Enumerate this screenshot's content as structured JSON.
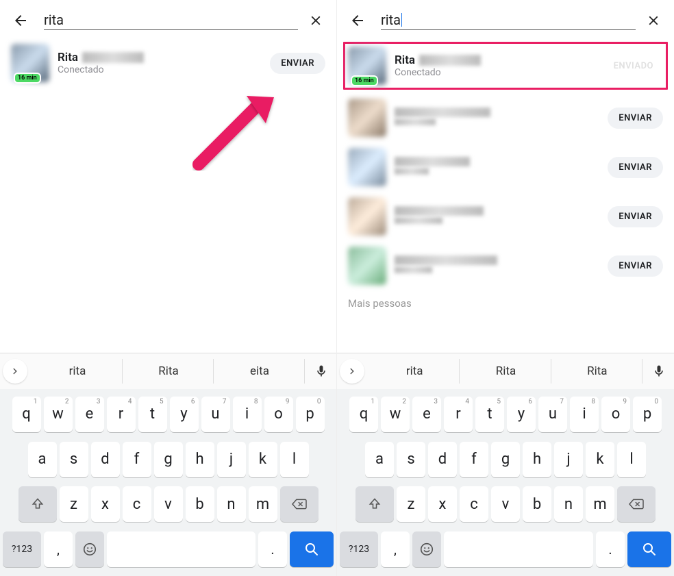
{
  "left": {
    "search_value": "rita",
    "contact": {
      "name": "Rita",
      "time_badge": "16 min",
      "status": "Conectado",
      "button_label": "ENVIAR"
    },
    "suggestions": [
      "rita",
      "Rita",
      "eita"
    ]
  },
  "right": {
    "search_value": "rita",
    "contacts": [
      {
        "name": "Rita",
        "time_badge": "16 min",
        "status": "Conectado",
        "button_label": "ENVIADO",
        "sent": true
      },
      {
        "button_label": "ENVIAR"
      },
      {
        "button_label": "ENVIAR"
      },
      {
        "button_label": "ENVIAR"
      },
      {
        "button_label": "ENVIAR"
      }
    ],
    "more_people_label": "Mais pessoas",
    "suggestions": [
      "rita",
      "Rita",
      "Rita"
    ]
  },
  "keyboard": {
    "row1": [
      {
        "k": "q",
        "s": "1"
      },
      {
        "k": "w",
        "s": "2"
      },
      {
        "k": "e",
        "s": "3"
      },
      {
        "k": "r",
        "s": "4"
      },
      {
        "k": "t",
        "s": "5"
      },
      {
        "k": "y",
        "s": "6"
      },
      {
        "k": "u",
        "s": "7"
      },
      {
        "k": "i",
        "s": "8"
      },
      {
        "k": "o",
        "s": "9"
      },
      {
        "k": "p",
        "s": "0"
      }
    ],
    "row2": [
      "a",
      "s",
      "d",
      "f",
      "g",
      "h",
      "j",
      "k",
      "l"
    ],
    "row3": [
      "z",
      "x",
      "c",
      "v",
      "b",
      "n",
      "m"
    ],
    "num_key": "?123",
    "comma": ",",
    "dot": "."
  }
}
